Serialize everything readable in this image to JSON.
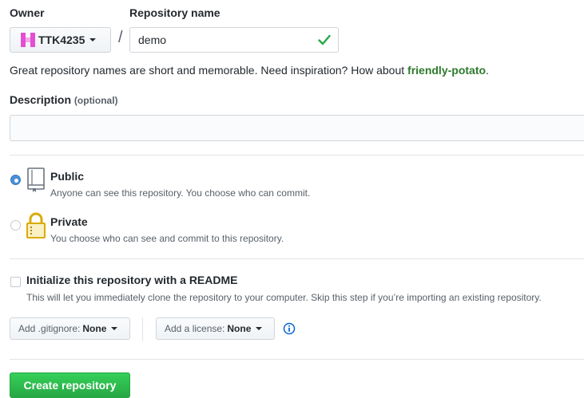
{
  "owner": {
    "label": "Owner",
    "selected": "TTK4235"
  },
  "repo_name": {
    "label": "Repository name",
    "value": "demo"
  },
  "name_hint": {
    "text": "Great repository names are short and memorable. Need inspiration? How about ",
    "suggestion": "friendly-potato",
    "end": "."
  },
  "description": {
    "label": "Description",
    "optional": "(optional)",
    "value": ""
  },
  "visibility": {
    "public": {
      "title": "Public",
      "desc": "Anyone can see this repository. You choose who can commit.",
      "selected": true
    },
    "private": {
      "title": "Private",
      "desc": "You choose who can see and commit to this repository.",
      "selected": false
    }
  },
  "readme": {
    "title": "Initialize this repository with a README",
    "desc": "This will let you immediately clone the repository to your computer. Skip this step if you’re importing an existing repository.",
    "checked": false
  },
  "gitignore": {
    "prefix": "Add .gitignore:",
    "value": "None"
  },
  "license": {
    "prefix": "Add a license:",
    "value": "None"
  },
  "create_button": "Create repository",
  "colors": {
    "accent": "#28a745",
    "radio": "#4a90d9",
    "avatar": "#e34fd3"
  }
}
